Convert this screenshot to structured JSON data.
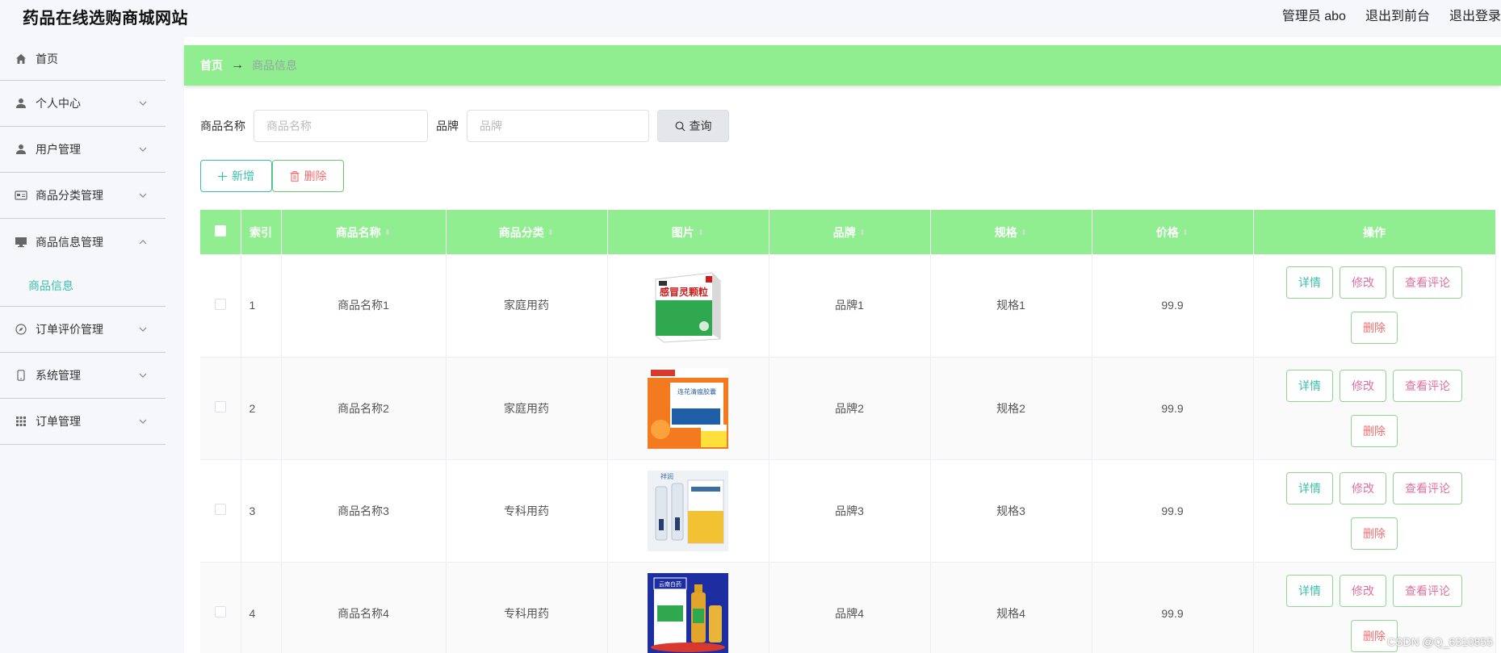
{
  "header": {
    "title": "药品在线选购商城网站",
    "admin": "管理员 abo",
    "front": "退出到前台",
    "logout": "退出登录"
  },
  "sidebar": {
    "items": [
      {
        "label": "首页",
        "icon": "home-icon"
      },
      {
        "label": "个人中心",
        "icon": "user-icon"
      },
      {
        "label": "用户管理",
        "icon": "user-icon"
      },
      {
        "label": "商品分类管理",
        "icon": "card-icon"
      },
      {
        "label": "商品信息管理",
        "icon": "monitor-icon"
      },
      {
        "label": "订单评价管理",
        "icon": "compass-icon"
      },
      {
        "label": "系统管理",
        "icon": "phone-icon"
      },
      {
        "label": "订单管理",
        "icon": "grid-icon"
      }
    ],
    "submenu": {
      "label": "商品信息"
    }
  },
  "breadcrumb": {
    "home": "首页",
    "arrow": "→",
    "current": "商品信息"
  },
  "search": {
    "name_label": "商品名称",
    "name_placeholder": "商品名称",
    "brand_label": "品牌",
    "brand_placeholder": "品牌",
    "button": "查询"
  },
  "actions": {
    "add": "新增",
    "delete": "删除"
  },
  "table": {
    "headers": [
      "索引",
      "商品名称",
      "商品分类",
      "图片",
      "品牌",
      "规格",
      "价格",
      "操作"
    ],
    "ops": {
      "detail": "详情",
      "edit": "修改",
      "review": "查看评论",
      "delete": "删除"
    },
    "rows": [
      {
        "index": "1",
        "name": "商品名称1",
        "category": "家庭用药",
        "brand": "品牌1",
        "spec": "规格1",
        "price": "99.9",
        "image_text": "感冒灵颗粒"
      },
      {
        "index": "2",
        "name": "商品名称2",
        "category": "家庭用药",
        "brand": "品牌2",
        "spec": "规格2",
        "price": "99.9",
        "image_text": "连花清瘟胶囊"
      },
      {
        "index": "3",
        "name": "商品名称3",
        "category": "专科用药",
        "brand": "品牌3",
        "spec": "规格3",
        "price": "99.9",
        "image_text": "祥润"
      },
      {
        "index": "4",
        "name": "商品名称4",
        "category": "专科用药",
        "brand": "品牌4",
        "spec": "规格4",
        "price": "99.9",
        "image_text": "云南白药"
      }
    ]
  },
  "watermark": "CSDN @Q_6310855",
  "colors": {
    "accent": "#90ee90",
    "teal": "#3cbfa8",
    "danger": "#f56c6c"
  }
}
